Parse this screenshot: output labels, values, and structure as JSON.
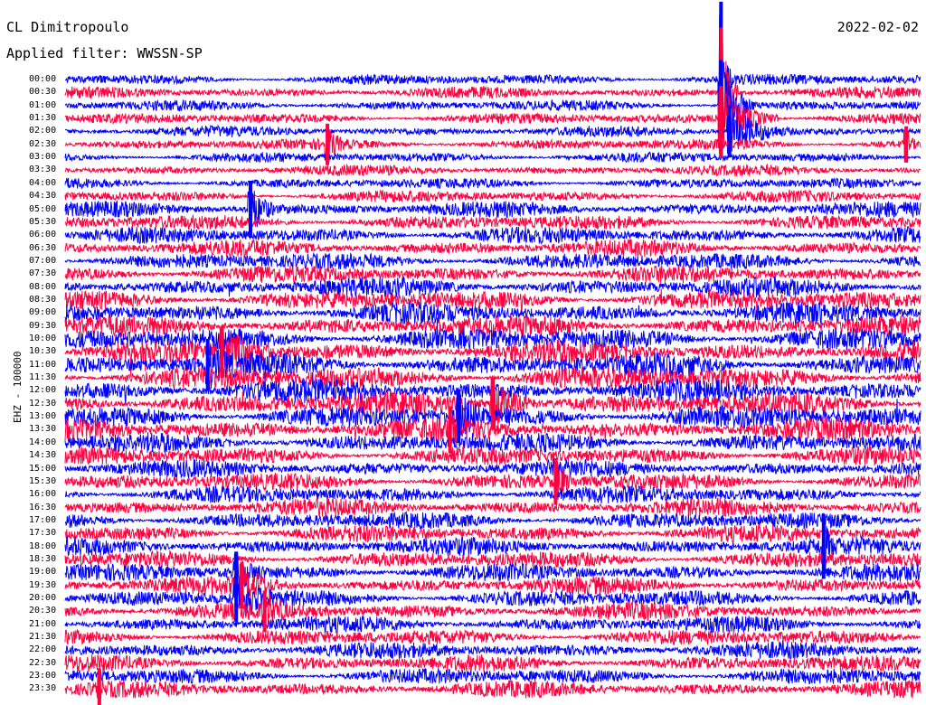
{
  "header": {
    "station": "CL Dimitropoulo",
    "date": "2022-02-02",
    "filter_label": "Applied filter: WWSSN-SP"
  },
  "channel_label": "EHZ - 100000",
  "chart_data": {
    "type": "helicorder",
    "station": "CL Dimitropoulo",
    "channel": "EHZ - 100000",
    "date": "2022-02-02",
    "filter": "WWSSN-SP",
    "row_minutes": 30,
    "colors": [
      "#0000ff",
      "#ff0040"
    ],
    "row_labels": [
      "00:00",
      "00:30",
      "01:00",
      "01:30",
      "02:00",
      "02:30",
      "03:00",
      "03:30",
      "04:00",
      "04:30",
      "05:00",
      "05:30",
      "06:00",
      "06:30",
      "07:00",
      "07:30",
      "08:00",
      "08:30",
      "09:00",
      "09:30",
      "10:00",
      "10:30",
      "11:00",
      "11:30",
      "12:00",
      "12:30",
      "13:00",
      "13:30",
      "14:00",
      "14:30",
      "15:00",
      "15:30",
      "16:00",
      "16:30",
      "17:00",
      "17:30",
      "18:00",
      "18:30",
      "19:00",
      "19:30",
      "20:00",
      "20:30",
      "21:00",
      "21:30",
      "22:00",
      "22:30",
      "23:00",
      "23:30"
    ],
    "noise_level": [
      0.15,
      0.15,
      0.13,
      0.13,
      0.13,
      0.15,
      0.13,
      0.13,
      0.13,
      0.2,
      0.35,
      0.35,
      0.4,
      0.4,
      0.45,
      0.45,
      0.55,
      0.55,
      0.6,
      0.6,
      0.7,
      0.7,
      0.75,
      0.75,
      0.75,
      0.75,
      0.7,
      0.7,
      0.55,
      0.5,
      0.45,
      0.45,
      0.45,
      0.45,
      0.45,
      0.45,
      0.45,
      0.45,
      0.45,
      0.45,
      0.45,
      0.45,
      0.4,
      0.4,
      0.4,
      0.4,
      0.4,
      0.4
    ],
    "events": [
      {
        "row": 0,
        "minute": 23,
        "amplitude": 6.0,
        "duration_min": 0.4
      },
      {
        "row": 1,
        "minute": 23,
        "amplitude": 5.0,
        "duration_min": 0.6
      },
      {
        "row": 2,
        "minute": 23,
        "amplitude": 3.5,
        "duration_min": 1.2
      },
      {
        "row": 3,
        "minute": 23,
        "amplitude": 2.5,
        "duration_min": 2.0
      },
      {
        "row": 4,
        "minute": 23.3,
        "amplitude": 2.0,
        "duration_min": 2.5
      },
      {
        "row": 5,
        "minute": 9.2,
        "amplitude": 1.6,
        "duration_min": 1.0
      },
      {
        "row": 5,
        "minute": 29.5,
        "amplitude": 1.4,
        "duration_min": 0.5
      },
      {
        "row": 10,
        "minute": 6.5,
        "amplitude": 2.2,
        "duration_min": 1.2
      },
      {
        "row": 21,
        "minute": 5.5,
        "amplitude": 2.0,
        "duration_min": 3.0
      },
      {
        "row": 22,
        "minute": 5.0,
        "amplitude": 2.0,
        "duration_min": 3.0
      },
      {
        "row": 25,
        "minute": 15.0,
        "amplitude": 2.0,
        "duration_min": 2.0
      },
      {
        "row": 26,
        "minute": 13.8,
        "amplitude": 2.0,
        "duration_min": 2.0
      },
      {
        "row": 27,
        "minute": 13.5,
        "amplitude": 1.8,
        "duration_min": 2.0
      },
      {
        "row": 31,
        "minute": 17.2,
        "amplitude": 1.8,
        "duration_min": 1.0
      },
      {
        "row": 36,
        "minute": 26.6,
        "amplitude": 2.5,
        "duration_min": 0.6
      },
      {
        "row": 38,
        "minute": 6.0,
        "amplitude": 1.6,
        "duration_min": 2.0
      },
      {
        "row": 39,
        "minute": 6.2,
        "amplitude": 1.8,
        "duration_min": 2.0
      },
      {
        "row": 40,
        "minute": 6.0,
        "amplitude": 1.8,
        "duration_min": 3.0
      },
      {
        "row": 41,
        "minute": 7.0,
        "amplitude": 1.6,
        "duration_min": 2.0
      },
      {
        "row": 47,
        "minute": 1.2,
        "amplitude": 1.6,
        "duration_min": 0.5
      }
    ]
  }
}
